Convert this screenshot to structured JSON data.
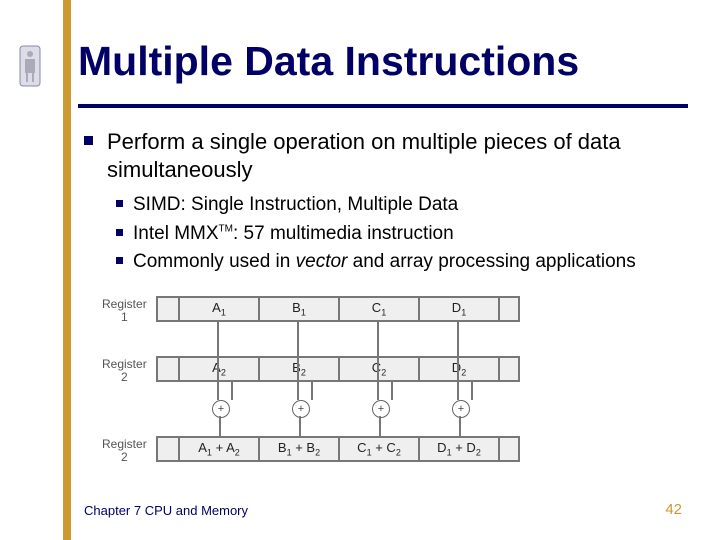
{
  "title": "Multiple Data Instructions",
  "bullet_main": "Perform a single operation on multiple pieces of data simultaneously",
  "sub_bullets": {
    "s1": "SIMD:  Single Instruction, Multiple Data",
    "s2a": "Intel MMX",
    "s2tm": "TM",
    "s2b": ":  57 multimedia instruction",
    "s3a": "Commonly used in ",
    "s3i": "vector",
    "s3b": " and array processing applications"
  },
  "diagram": {
    "reg1_label": "Register\n1",
    "reg2_label": "Register\n2",
    "reg3_label": "Register\n2",
    "row1": {
      "a": "A",
      "b": "B",
      "c": "C",
      "d": "D",
      "sub": "1"
    },
    "row2": {
      "a": "A",
      "b": "B",
      "c": "C",
      "d": "D",
      "sub": "2"
    },
    "row3": {
      "c1a": "A",
      "c1b": "A",
      "c2a": "B",
      "c2b": "B",
      "c3a": "C",
      "c3b": "C",
      "c4a": "D",
      "c4b": "D",
      "s1": "1",
      "s2": "2",
      "plus": "+"
    },
    "plus_sym": "+"
  },
  "footer": {
    "left": "Chapter 7 CPU and Memory",
    "right": "42"
  }
}
